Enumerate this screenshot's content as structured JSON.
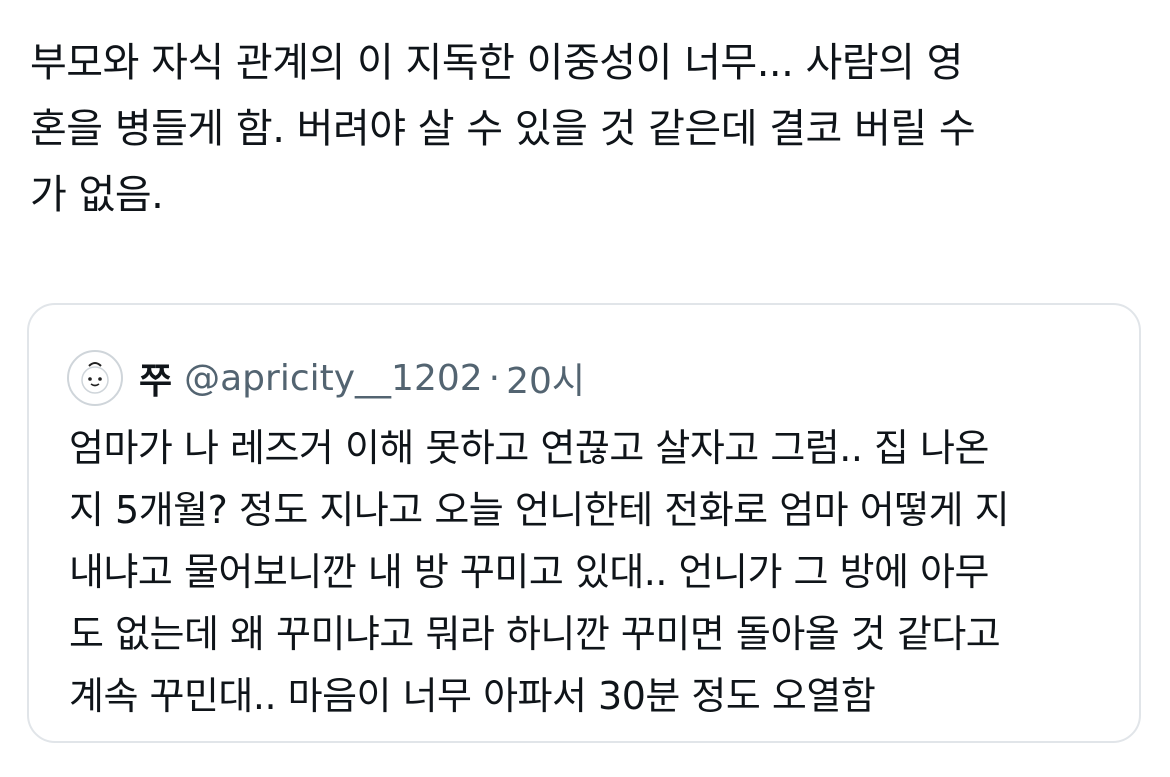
{
  "tweet": {
    "text": "부모와 자식 관계의 이 지독한 이중성이 너무... 사람의 영\n혼을 병들게 함. 버려야 살 수 있을 것 같은데 결코 버릴 수\n가 없음."
  },
  "quote": {
    "avatar_icon": "smiling-face-avatar",
    "display_name": "쭈",
    "handle": "@apricity__1202",
    "separator": "·",
    "time": "20시",
    "text": "엄마가 나 레즈거 이해 못하고 연끊고 살자고 그럼.. 집 나온\n지 5개월? 정도 지나고 오늘 언니한테 전화로 엄마 어떻게 지\n내냐고 물어보니깐 내 방 꾸미고 있대.. 언니가 그 방에 아무\n도 없는데 왜 꾸미냐고 뭐라 하니깐 꾸미면 돌아올 것 같다고\n계속 꾸민대.. 마음이 너무 아파서 30분 정도 오열함"
  }
}
